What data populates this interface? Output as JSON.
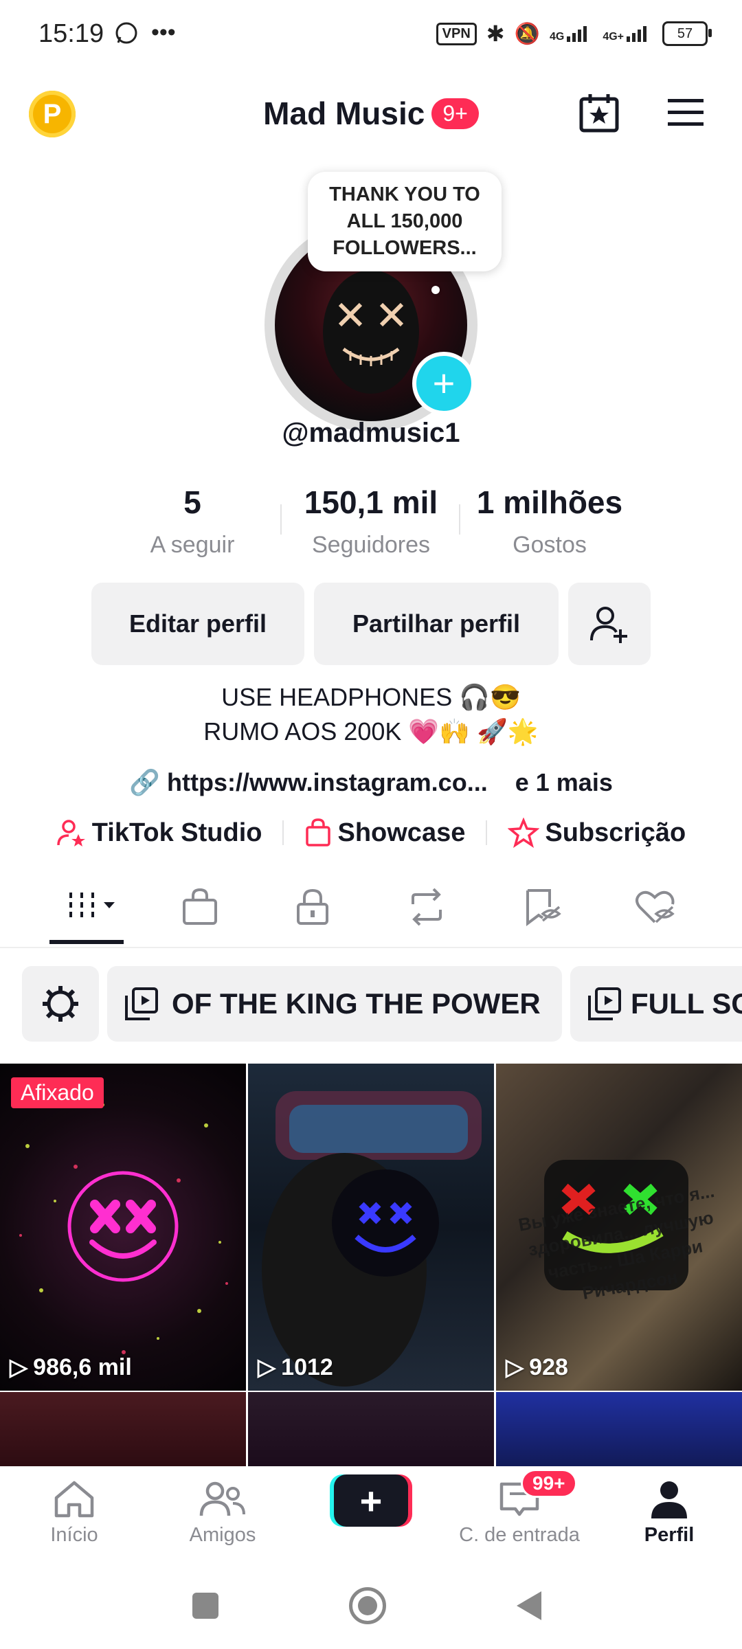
{
  "status_bar": {
    "time": "15:19",
    "vpn": "VPN",
    "net1": "4G",
    "net2": "4G+",
    "battery": "57"
  },
  "header": {
    "title": "Mad Music",
    "badge": "9+",
    "coin": "P"
  },
  "profile": {
    "speech_bubble": "THANK YOU TO ALL 150,000 FOLLOWERS...",
    "handle": "@madmusic1",
    "stats": [
      {
        "value": "5",
        "label": "A seguir"
      },
      {
        "value": "150,1 mil",
        "label": "Seguidores"
      },
      {
        "value": "1 milhões",
        "label": "Gostos"
      }
    ],
    "buttons": {
      "edit": "Editar perfil",
      "share": "Partilhar perfil"
    },
    "bio_line1": "USE HEADPHONES 🎧😎",
    "bio_line2": "RUMO AOS 200K 💗🙌 🚀🌟",
    "link": "https://www.instagram.co...",
    "link_more": "e 1 mais",
    "studio": "TikTok Studio",
    "showcase": "Showcase",
    "subscription": "Subscrição"
  },
  "playlists": [
    {
      "label": "OF THE KING THE POWER"
    },
    {
      "label": "FULL SC"
    }
  ],
  "videos": [
    {
      "views": "986,6 mil",
      "pinned": "Afixado",
      "overlay": ""
    },
    {
      "views": "1012",
      "pinned": "",
      "overlay": ""
    },
    {
      "views": "928",
      "pinned": "",
      "overlay": "Вы уже знаете, что я... здоровила... лучшую часть... Ша Карри Ричардсон"
    }
  ],
  "bottom_nav": [
    {
      "label": "Início"
    },
    {
      "label": "Amigos"
    },
    {
      "label": ""
    },
    {
      "label": "C. de entrada",
      "badge": "99+"
    },
    {
      "label": "Perfil"
    }
  ],
  "colors": {
    "accent": "#fe2c55",
    "cyan": "#20d5ec",
    "text": "#161823",
    "secondary": "#8a8b91"
  }
}
